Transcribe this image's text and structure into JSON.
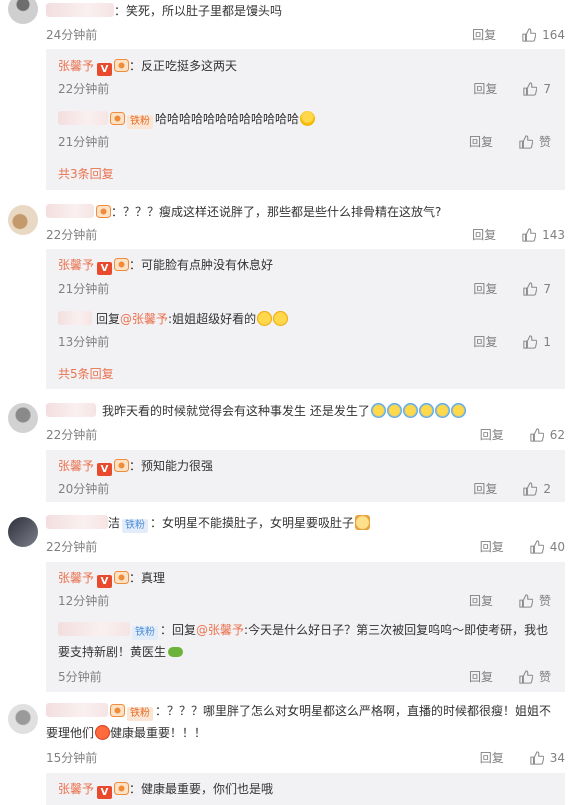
{
  "labels": {
    "reply": "回复",
    "like_zero": "赞"
  },
  "comments": [
    {
      "text": "：笑死，所以肚子里都是馒头吗",
      "time": "24分钟前",
      "likes": "164",
      "replies": [
        {
          "user": "张馨予",
          "sep": "：",
          "text": "反正吃挺多这两天",
          "time": "22分钟前",
          "likes": "7"
        },
        {
          "badge": "铁粉",
          "text": "哈哈哈哈哈哈哈哈哈哈哈哈",
          "time": "21分钟前",
          "likes": "赞"
        }
      ],
      "more": "共3条回复"
    },
    {
      "text": "：？？？瘦成这样还说胖了，那些都是些什么排骨精在这放气?",
      "time": "22分钟前",
      "likes": "143",
      "replies": [
        {
          "user": "张馨予",
          "sep": "：",
          "text": "可能脸有点肿没有休息好",
          "time": "21分钟前",
          "likes": "7"
        },
        {
          "prefix": "回复",
          "at": "@张馨予",
          "text": ":姐姐超级好看的",
          "time": "13分钟前",
          "likes": "1"
        }
      ],
      "more": "共5条回复"
    },
    {
      "text": "我昨天看的时候就觉得会有这种事发生 还是发生了",
      "time": "22分钟前",
      "likes": "62",
      "replies": [
        {
          "user": "张馨予",
          "sep": "：",
          "text": "预知能力很强",
          "time": "20分钟前",
          "likes": "2"
        }
      ]
    },
    {
      "name_tail": "洁",
      "badge": "铁粉",
      "text": "：女明星不能摸肚子，女明星要吸肚子",
      "time": "22分钟前",
      "likes": "40",
      "replies": [
        {
          "user": "张馨予",
          "sep": "：",
          "text": "真理",
          "time": "12分钟前",
          "likes": "赞"
        },
        {
          "badge": "铁粉",
          "sep": "：",
          "prefix": "回复",
          "at": "@张馨予",
          "text": ":今天是什么好日子？第三次被回复呜呜～即使考研，我也要支持新剧！黄医生",
          "time": "5分钟前",
          "likes": "赞"
        }
      ]
    },
    {
      "badge": "铁粉",
      "text": "：？？？哪里胖了怎么对女明星都这么严格啊，直播的时候都很瘦！姐姐不要理他们",
      "text_tail": "健康最重要！！！",
      "time": "15分钟前",
      "likes": "34",
      "replies": [
        {
          "user": "张馨予",
          "sep": "：",
          "text": "健康最重要，你们也是哦"
        }
      ]
    }
  ],
  "colors": {
    "accent": "#eb7350",
    "meta": "#808080",
    "reply_bg": "#f2f2f5",
    "vip_badge": "#e94a2d"
  },
  "icons": [
    "thumb-up-icon",
    "verified-v-icon",
    "fan-badge-icon",
    "emoji-icon"
  ]
}
